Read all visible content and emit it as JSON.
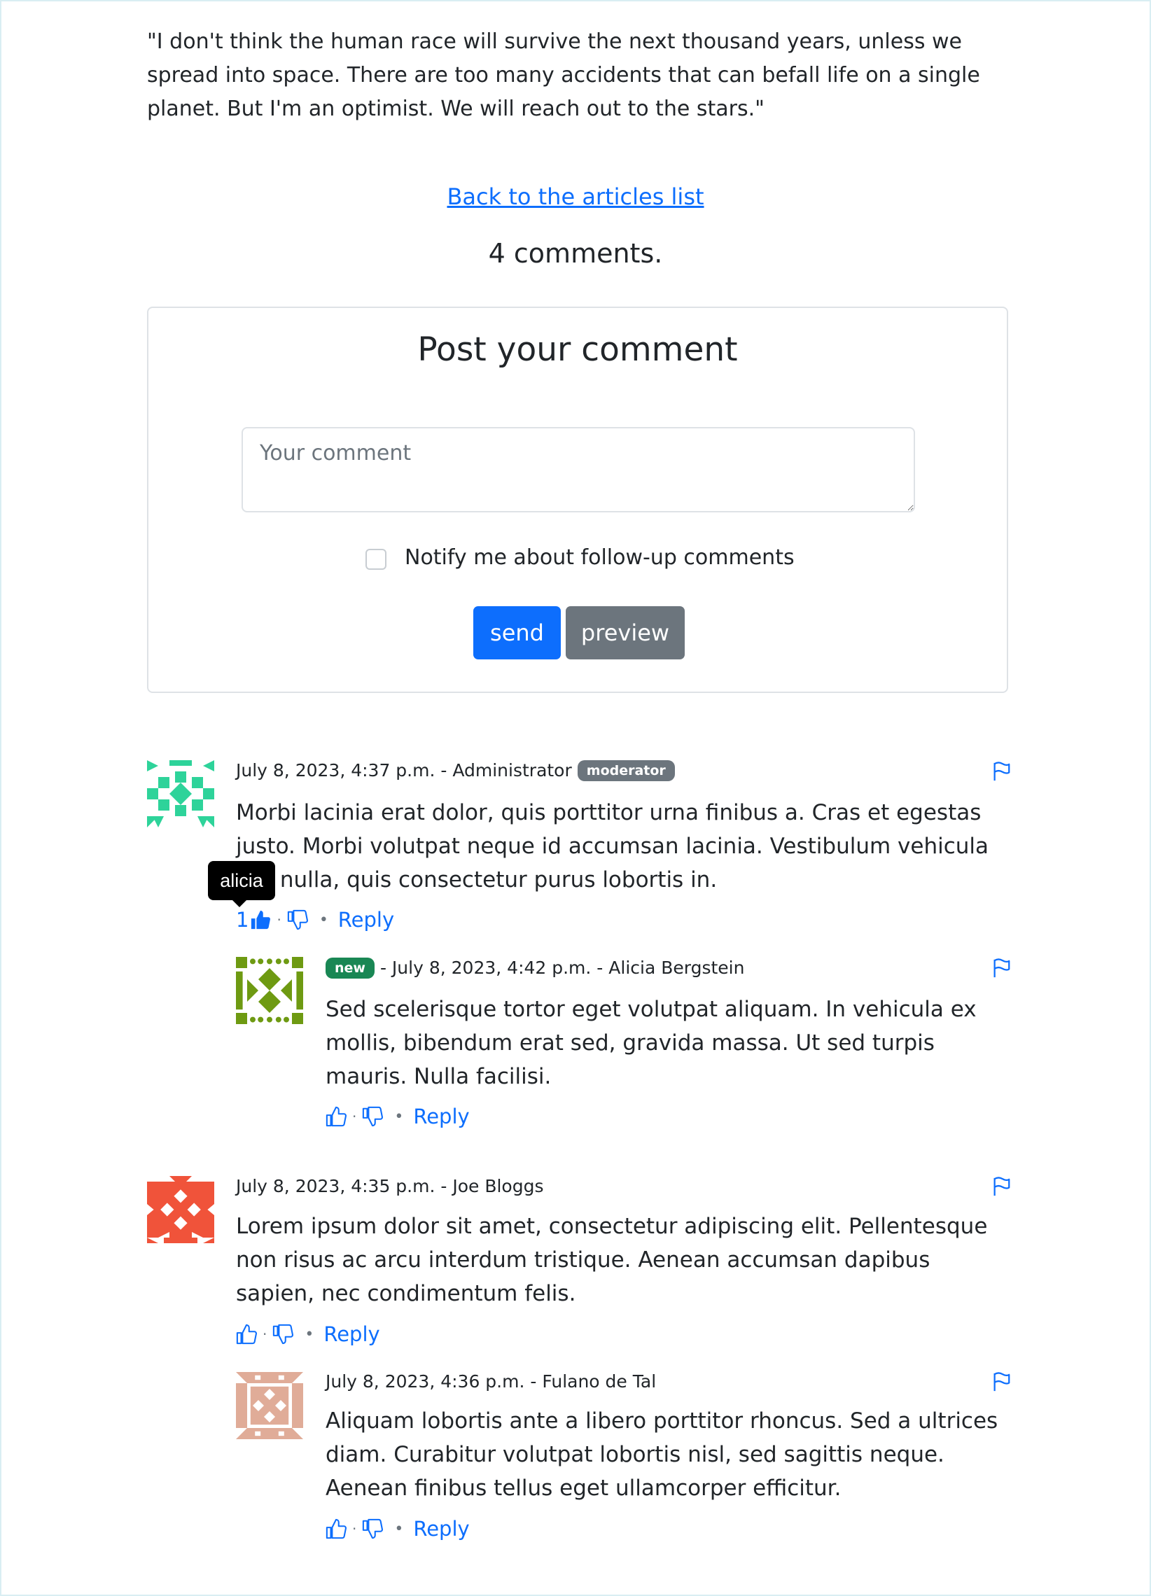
{
  "article": {
    "quote": "\"I don't think the human race will survive the next thousand years, unless we spread into space. There are too many accidents that can befall life on a single planet. But I'm an optimist. We will reach out to the stars.\"",
    "back_link": "Back to the articles list",
    "comment_count": "4 comments."
  },
  "form": {
    "title": "Post your comment",
    "placeholder": "Your comment",
    "notify_label": "Notify me about follow-up comments",
    "send_label": "send",
    "preview_label": "preview"
  },
  "tooltip": {
    "text": "alicia"
  },
  "comments": [
    {
      "meta": "July 8, 2023, 4:37 p.m. - Administrator",
      "badge": "moderator",
      "body": "Morbi lacinia erat dolor, quis porttitor urna finibus a. Cras et egestas justo. Morbi volutpat neque id accumsan lacinia. Vestibulum vehicula nisl nulla, quis consectetur purus lobortis in.",
      "likes": "1",
      "reply": "Reply",
      "avatar_color": "#2ed39a"
    },
    {
      "badge": "new",
      "meta": "- July 8, 2023, 4:42 p.m. - Alicia Bergstein",
      "body": "Sed scelerisque tortor eget volutpat aliquam. In vehicula ex mollis, bibendum erat sed, gravida massa. Ut sed turpis mauris. Nulla facilisi.",
      "reply": "Reply",
      "avatar_color": "#6e9a12"
    },
    {
      "meta": "July 8, 2023, 4:35 p.m. - Joe Bloggs",
      "body": "Lorem ipsum dolor sit amet, consectetur adipiscing elit. Pellentesque non risus ac arcu interdum tristique. Aenean accumsan dapibus sapien, nec condimentum felis.",
      "reply": "Reply",
      "avatar_color": "#f0533a"
    },
    {
      "meta": "July 8, 2023, 4:36 p.m. - Fulano de Tal",
      "body": "Aliquam lobortis ante a libero porttitor rhoncus. Sed a ultrices diam. Curabitur volutpat lobortis nisl, sed sagittis neque. Aenean finibus tellus eget ullamcorper efficitur.",
      "reply": "Reply",
      "avatar_color": "#e0ac98"
    }
  ]
}
